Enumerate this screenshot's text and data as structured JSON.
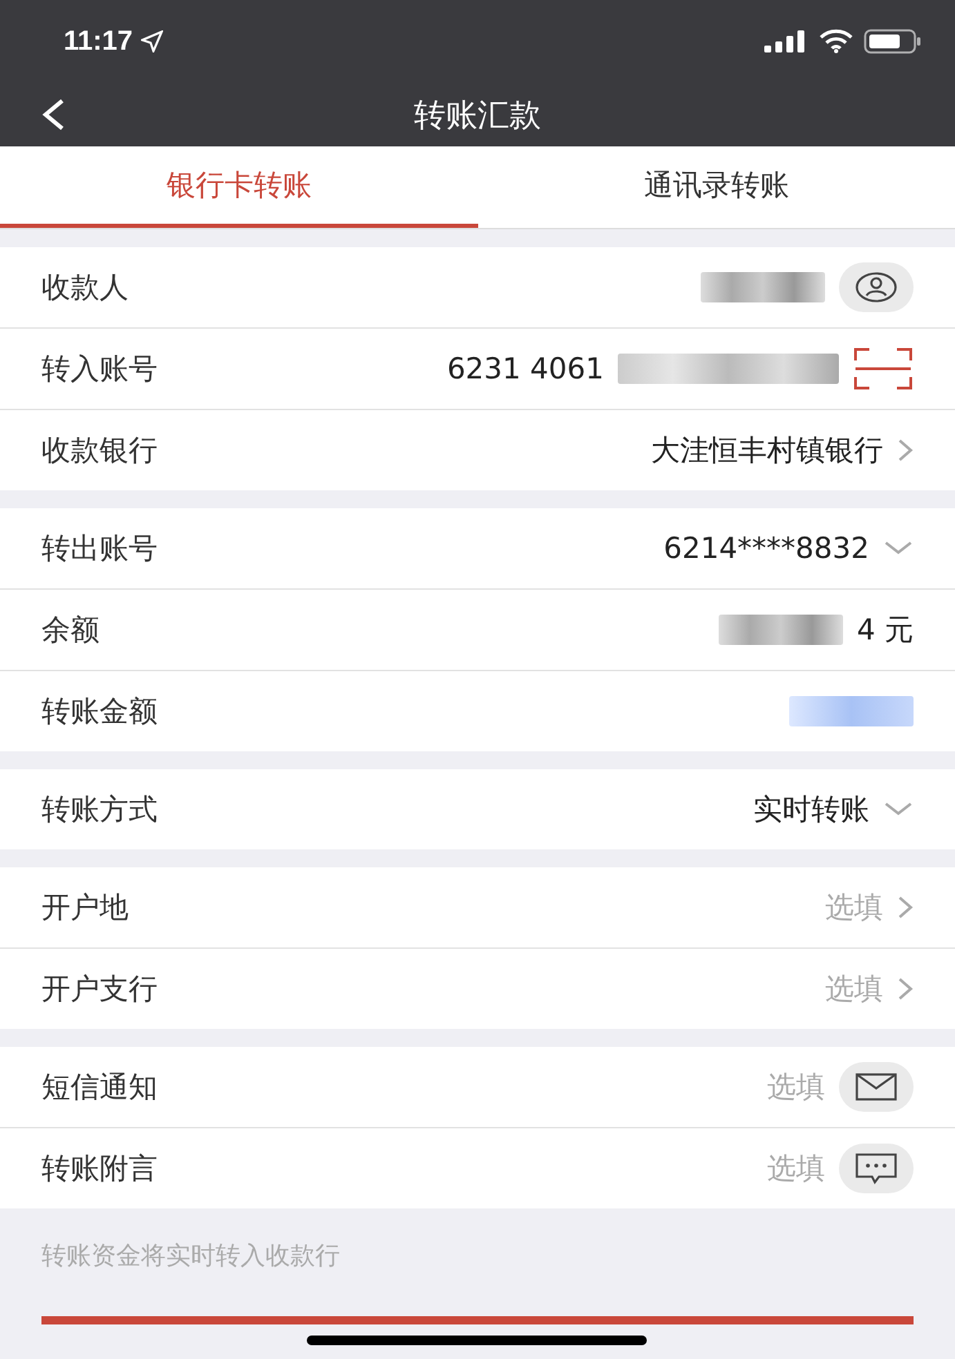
{
  "status_bar": {
    "time": "11:17"
  },
  "nav": {
    "title": "转账汇款"
  },
  "tabs": [
    {
      "label": "银行卡转账",
      "selected": true
    },
    {
      "label": "通讯录转账",
      "selected": false
    }
  ],
  "sections": [
    {
      "rows": [
        {
          "label": "收款人",
          "blurred": true,
          "kind": "contact"
        },
        {
          "label": "转入账号",
          "value": "6231 4061",
          "blurred": true,
          "kind": "scan"
        },
        {
          "label": "收款银行",
          "value": "大洼恒丰村镇银行",
          "blurred": false,
          "kind": "link"
        }
      ]
    },
    {
      "rows": [
        {
          "label": "转出账号",
          "value": "6214****8832",
          "blurred": false,
          "kind": "dropdown"
        },
        {
          "label": "余额",
          "value": "4 元",
          "blurred": true,
          "kind": "balance"
        },
        {
          "label": "转账金额",
          "blurred": true,
          "kind": "amount"
        }
      ]
    },
    {
      "rows": [
        {
          "label": "转账方式",
          "value": "实时转账",
          "blurred": false,
          "kind": "dropdown"
        }
      ]
    },
    {
      "rows": [
        {
          "label": "开户地",
          "placeholder": "选填",
          "blurred": false,
          "kind": "link"
        },
        {
          "label": "开户支行",
          "placeholder": "选填",
          "blurred": false,
          "kind": "link"
        }
      ]
    },
    {
      "rows": [
        {
          "label": "短信通知",
          "placeholder": "选填",
          "blurred": false,
          "kind": "sms"
        },
        {
          "label": "转账附言",
          "placeholder": "选填",
          "blurred": false,
          "kind": "message"
        }
      ]
    }
  ],
  "note": "转账资金将实时转入收款行"
}
